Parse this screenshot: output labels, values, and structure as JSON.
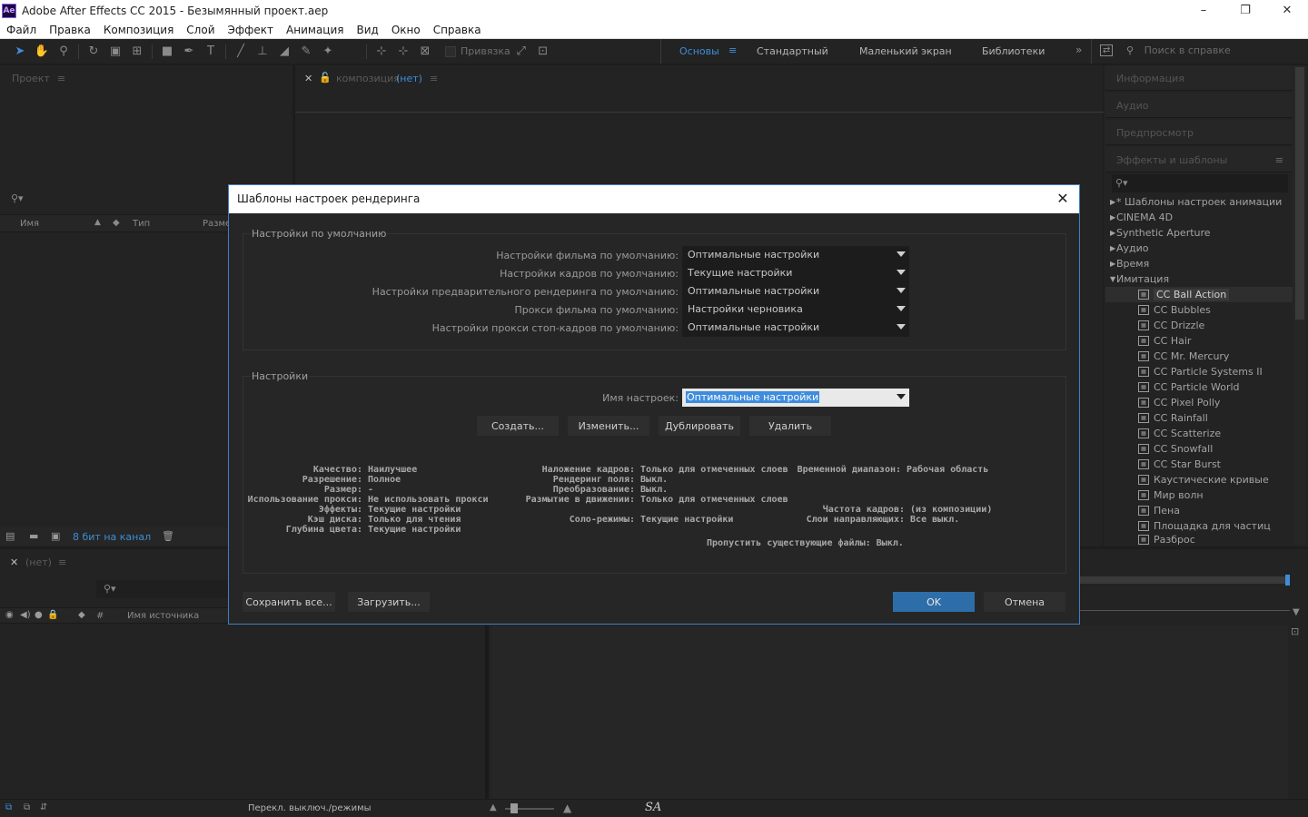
{
  "window": {
    "title": "Adobe After Effects CC 2015 - Безымянный проект.aep",
    "app_icon": "Ae",
    "minimize": "–",
    "restore": "❐",
    "close": "✕"
  },
  "menu": [
    "Файл",
    "Правка",
    "Композиция",
    "Слой",
    "Эффект",
    "Анимация",
    "Вид",
    "Окно",
    "Справка"
  ],
  "toolbar": {
    "snap_label": "Привязка",
    "workspaces": [
      "Основы",
      "Стандартный",
      "Маленький экран",
      "Библиотеки"
    ],
    "help_placeholder": "Поиск в справке"
  },
  "project_panel": {
    "title": "Проект",
    "columns": [
      "Имя",
      "Тип",
      "Размер"
    ],
    "bit_depth": "8 бит на канал"
  },
  "comp_panel": {
    "title": "композиция",
    "comp_name": "(нет)"
  },
  "timeline_panel": {
    "title": "(нет)",
    "columns": [
      "#",
      "Имя источника"
    ],
    "footer_toggle": "Перекл. выключ./режимы"
  },
  "right_panels": [
    "Информация",
    "Аудио",
    "Предпросмотр",
    "Эффекты и шаблоны"
  ],
  "effects_tree": {
    "categories": [
      {
        "label": "* Шаблоны настроек анимации",
        "open": false
      },
      {
        "label": "CINEMA 4D",
        "open": false
      },
      {
        "label": "Synthetic Aperture",
        "open": false
      },
      {
        "label": "Аудио",
        "open": false
      },
      {
        "label": "Время",
        "open": false
      },
      {
        "label": "Имитация",
        "open": true
      }
    ],
    "items": [
      "CC Ball Action",
      "CC Bubbles",
      "CC Drizzle",
      "CC Hair",
      "CC Mr. Mercury",
      "CC Particle Systems II",
      "CC Particle World",
      "CC Pixel Polly",
      "CC Rainfall",
      "CC Scatterize",
      "CC Snowfall",
      "CC Star Burst",
      "Каустические кривые",
      "Мир волн",
      "Пена",
      "Площадка для частиц",
      "Разброс"
    ],
    "selected": "CC Ball Action"
  },
  "dialog": {
    "title": "Шаблоны настроек рендеринга",
    "defaults_group": "Настройки по умолчанию",
    "defaults": [
      {
        "label": "Настройки фильма по умолчанию:",
        "value": "Оптимальные настройки"
      },
      {
        "label": "Настройки кадров по умолчанию:",
        "value": "Текущие настройки"
      },
      {
        "label": "Настройки предварительного рендеринга по умолчанию:",
        "value": "Оптимальные настройки"
      },
      {
        "label": "Прокси фильма по умолчанию:",
        "value": "Настройки черновика"
      },
      {
        "label": "Настройки прокси стоп-кадров по умолчанию:",
        "value": "Оптимальные настройки"
      }
    ],
    "settings_group": "Настройки",
    "name_label": "Имя настроек:",
    "name_value": "Оптимальные настройки",
    "buttons": [
      "Создать...",
      "Изменить...",
      "Дублировать",
      "Удалить"
    ],
    "info_col1": [
      {
        "k": "Качество:",
        "v": "Наилучшее"
      },
      {
        "k": "Разрешение:",
        "v": "Полное"
      },
      {
        "k": "Размер:",
        "v": "-"
      },
      {
        "k": "Использование прокси:",
        "v": "Не использовать прокси"
      },
      {
        "k": "Эффекты:",
        "v": "Текущие настройки"
      },
      {
        "k": "Кэш диска:",
        "v": "Только для чтения"
      },
      {
        "k": "Глубина цвета:",
        "v": "Текущие настройки"
      }
    ],
    "info_col2": [
      {
        "k": "Наложение кадров:",
        "v": "Только для отмеченных слоев"
      },
      {
        "k": "Рендеринг поля:",
        "v": "Выкл."
      },
      {
        "k": "Преобразование:",
        "v": "Выкл."
      },
      {
        "k": "Размытие в движении:",
        "v": "Только для отмеченных слоев"
      },
      {
        "k": "",
        "v": ""
      },
      {
        "k": "Соло-режимы:",
        "v": "Текущие настройки"
      }
    ],
    "info_col3": [
      {
        "k": "Временной диапазон:",
        "v": "Рабочая область"
      },
      {
        "k": "",
        "v": ""
      },
      {
        "k": "",
        "v": ""
      },
      {
        "k": "",
        "v": ""
      },
      {
        "k": "Частота кадров:",
        "v": "(из композиции)"
      },
      {
        "k": "Слои направляющих:",
        "v": "Все выкл."
      }
    ],
    "skip_files": {
      "k": "Пропустить существующие файлы:",
      "v": "Выкл."
    },
    "save_all": "Сохранить все...",
    "load": "Загрузить...",
    "ok": "OK",
    "cancel": "Отмена"
  }
}
